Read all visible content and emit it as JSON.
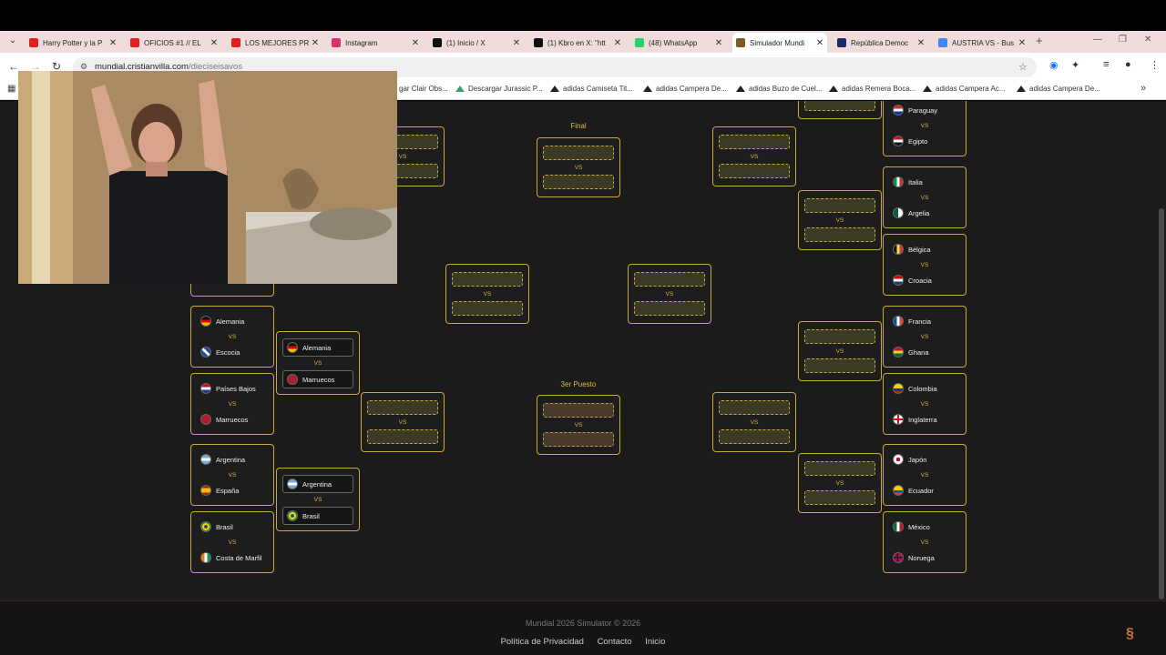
{
  "browser": {
    "tabs": [
      {
        "title": "Harry Potter y la P",
        "color": "#e02020",
        "active": false
      },
      {
        "title": "OFICIOS #1 // EL",
        "color": "#e02020",
        "active": false
      },
      {
        "title": "LOS MEJORES PR",
        "color": "#e02020",
        "active": false
      },
      {
        "title": "Instagram",
        "color": "#d6336c",
        "active": false
      },
      {
        "title": "(1) Inicio / X",
        "color": "#111111",
        "active": false
      },
      {
        "title": "(1) Kbro en X: \"htt",
        "color": "#111111",
        "active": false
      },
      {
        "title": "(48) WhatsApp",
        "color": "#25d366",
        "active": false
      },
      {
        "title": "Simulador Mundi",
        "color": "#7a5a20",
        "active": true
      },
      {
        "title": "República Democ",
        "color": "#1a2a6a",
        "active": false
      },
      {
        "title": "AUSTRIA VS - Bus",
        "color": "#4285f4",
        "active": false
      }
    ],
    "url_host": "mundial.cristianvilla.com",
    "url_path": "/dieciseisavos",
    "bookmarks": [
      "gar Clair Obs...",
      "Descargar Jurassic P...",
      "adidas Camiseta Tit...",
      "adidas Campera De...",
      "adidas Buzo de Cuel...",
      "adidas Remera Boca...",
      "adidas Campera Ac...",
      "adidas Campera De..."
    ]
  },
  "bracket": {
    "vs": "VS",
    "final_label": "Final",
    "third_label": "3er Puesto",
    "left_r32": [
      {
        "a": "Alemania",
        "b": "Escocia"
      },
      {
        "a": "Países Bajos",
        "b": "Marruecos"
      },
      {
        "a": "Argentina",
        "b": "España"
      },
      {
        "a": "Brasil",
        "b": "Costa de Marfil"
      }
    ],
    "left_r16": [
      {
        "a": "Alemania",
        "b": "Marruecos"
      },
      {
        "a": "Argentina",
        "b": "Brasil"
      }
    ],
    "right_r32": [
      {
        "a": "Paraguay",
        "b": "Egipto"
      },
      {
        "a": "Italia",
        "b": "Argelia"
      },
      {
        "a": "Bélgica",
        "b": "Croacia"
      },
      {
        "a": "Francia",
        "b": "Ghana"
      },
      {
        "a": "Colombia",
        "b": "Inglaterra"
      },
      {
        "a": "Japón",
        "b": "Ecuador"
      },
      {
        "a": "México",
        "b": "Noruega"
      }
    ]
  },
  "footer": {
    "copyright": "Mundial 2026 Simulator © 2026",
    "links": [
      "Política de Privacidad",
      "Contacto",
      "Inicio"
    ]
  }
}
